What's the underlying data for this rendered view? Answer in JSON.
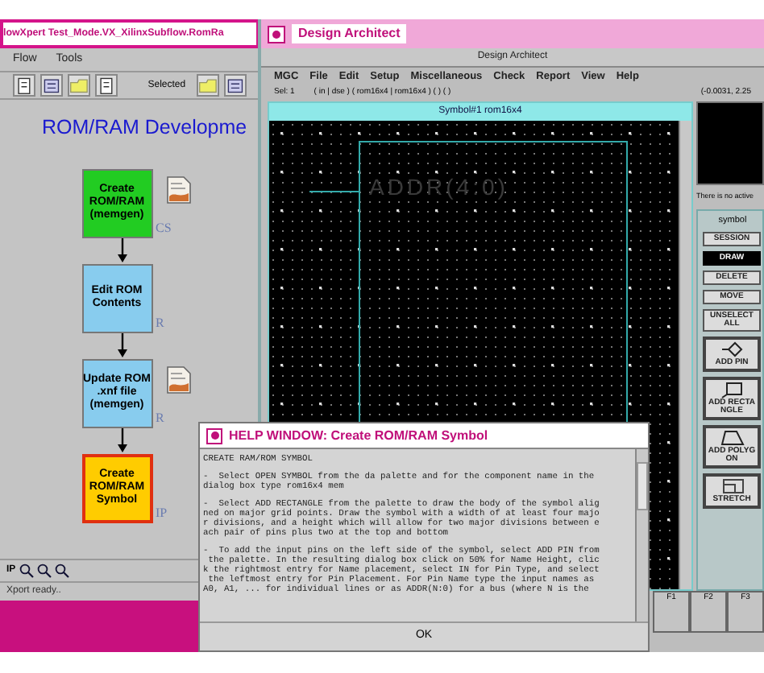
{
  "flow_window": {
    "title": "lowXpert Test_Mode.VX_XilinxSubflow.RomRa",
    "menu": [
      "Flow",
      "Tools"
    ],
    "toolbar_label": "Selected",
    "heading": "ROM/RAM Developme",
    "steps": [
      {
        "label": "Create ROM/RAM (memgen)",
        "tag": "CS",
        "color": "#22cc22",
        "has_log": true,
        "selected": false
      },
      {
        "label": "Edit ROM Contents",
        "tag": "R",
        "color": "#88ccee",
        "has_log": false,
        "selected": false
      },
      {
        "label": "Update ROM .xnf file (memgen)",
        "tag": "R",
        "color": "#88ccee",
        "has_log": true,
        "selected": false
      },
      {
        "label": "Create ROM/RAM Symbol",
        "tag": "IP",
        "color": "#ffcc00",
        "has_log": false,
        "selected": true
      }
    ],
    "bottom_label": "IP",
    "status": "Xport ready.."
  },
  "da_window": {
    "title": "Design Architect",
    "inner_title": "Design Architect",
    "menu": [
      "MGC",
      "File",
      "Edit",
      "Setup",
      "Miscellaneous",
      "Check",
      "Report",
      "View",
      "Help"
    ],
    "status_left": "Sel: 1",
    "status_middle": "( in | dse ) ( rom16x4 | rom16x4 ) ( ) ( )",
    "status_right": "(-0.0031, 2.25",
    "symbol_window": {
      "title": "Symbol#1 rom16x4",
      "bus_label": "ADDR(4:0)"
    },
    "side": {
      "message": "There is no active",
      "palette_title": "symbol",
      "buttons": [
        {
          "kind": "text",
          "label": "SESSION",
          "selected": false
        },
        {
          "kind": "text",
          "label": "DRAW",
          "selected": true
        },
        {
          "kind": "text",
          "label": "DELETE",
          "selected": false
        },
        {
          "kind": "text",
          "label": "MOVE",
          "selected": false
        },
        {
          "kind": "text",
          "label": "UNSELECT ALL",
          "selected": false
        },
        {
          "kind": "pin",
          "label": "ADD PIN",
          "selected": false
        },
        {
          "kind": "rectangle",
          "label": "ADD RECTANGLE",
          "selected": false
        },
        {
          "kind": "polygon",
          "label": "ADD POLYGON",
          "selected": false
        },
        {
          "kind": "stretch",
          "label": "STRETCH",
          "selected": false
        }
      ]
    },
    "function_keys": [
      "F1",
      "F2",
      "F3"
    ]
  },
  "help_window": {
    "title": "HELP WINDOW: Create ROM/RAM Symbol",
    "paragraphs": [
      [
        "CREATE RAM/ROM SYMBOL"
      ],
      [
        "-  Select OPEN SYMBOL from the da palette and for the component name in the",
        "dialog box type rom16x4 mem"
      ],
      [
        "-  Select ADD RECTANGLE from the palette to draw the body of the symbol alig",
        "ned on major grid points. Draw the symbol with a width of at least four majo",
        "r divisions, and a height which will allow for two major divisions between e",
        "ach pair of pins plus two at the top and bottom"
      ],
      [
        "-  To add the input pins on the left side of the symbol, select ADD PIN from",
        " the palette. In the resulting dialog box click on 50% for Name Height, clic",
        "k the rightmost entry for Name placement, select IN for Pin Type, and select",
        " the leftmost entry for Pin Placement. For Pin Name type the input names as",
        "A0, A1, ... for individual lines or as ADDR(N:0) for a bus (where N is the"
      ]
    ],
    "button": "OK"
  }
}
